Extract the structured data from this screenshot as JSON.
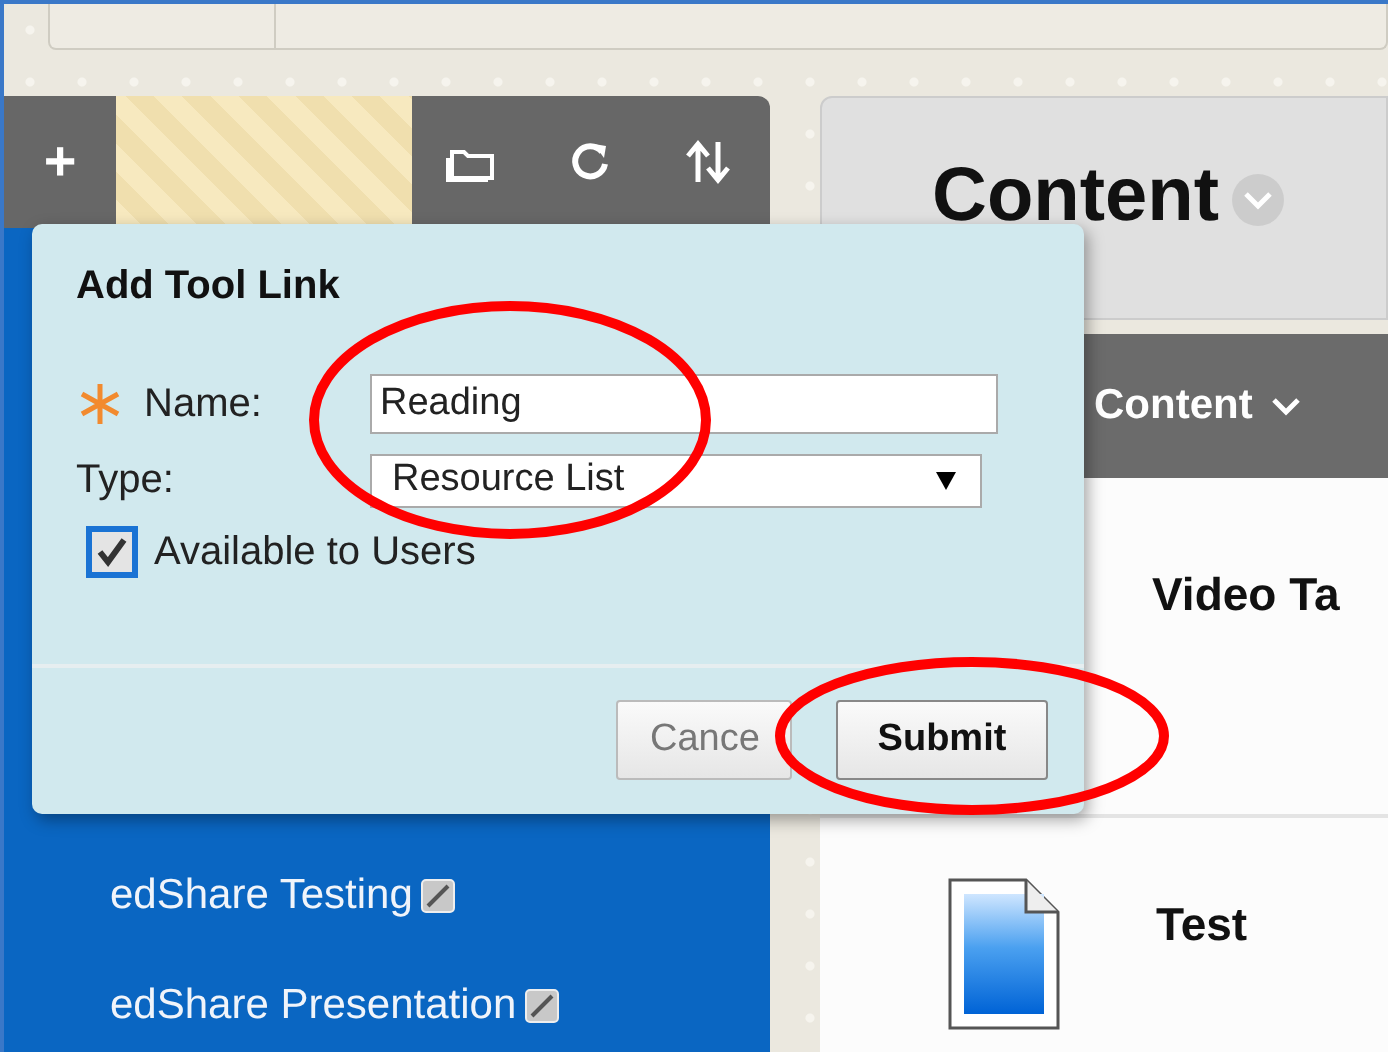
{
  "toolbar": {
    "add_label": "+"
  },
  "sidebar": {
    "items": [
      {
        "label": "edShare Testing"
      },
      {
        "label": "edShare Presentation"
      }
    ]
  },
  "content_header": {
    "title": "Content"
  },
  "menu_bar": {
    "label": "Content"
  },
  "content_items": [
    {
      "title": "Video Ta",
      "kind": "heading"
    },
    {
      "title": "Test",
      "kind": "document"
    }
  ],
  "dialog": {
    "title": "Add Tool Link",
    "name_field": {
      "label": "Name:",
      "value": "Reading",
      "required": true
    },
    "type_field": {
      "label": "Type:",
      "value": "Resource List"
    },
    "available": {
      "label": "Available to Users",
      "checked": true
    },
    "buttons": [
      {
        "label": "Cance",
        "kind": "secondary"
      },
      {
        "label": "Submit",
        "kind": "primary"
      }
    ]
  }
}
